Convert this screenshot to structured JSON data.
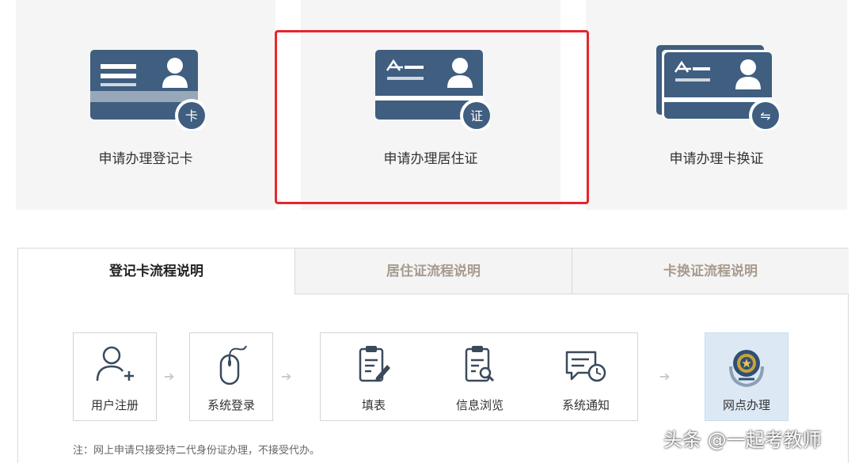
{
  "cards": [
    {
      "label": "申请办理登记卡",
      "badge": "卡"
    },
    {
      "label": "申请办理居住证",
      "badge": "证"
    },
    {
      "label": "申请办理卡换证",
      "badge": "⇋"
    }
  ],
  "tabs": [
    {
      "label": "登记卡流程说明",
      "active": true
    },
    {
      "label": "居住证流程说明",
      "active": false
    },
    {
      "label": "卡换证流程说明",
      "active": false
    }
  ],
  "steps": {
    "register": "用户注册",
    "login": "系统登录",
    "fill": "填表",
    "browse": "信息浏览",
    "notify": "系统通知",
    "office": "网点办理"
  },
  "note": "注：网上申请只接受持二代身份证办理，不接受代办。",
  "watermark": "头条 @一起考教师",
  "colors": {
    "card_icon": "#3f5e80",
    "highlight": "#e6262b",
    "tab_inactive_text": "#a89a8e",
    "office_bg": "#dce9f5"
  }
}
